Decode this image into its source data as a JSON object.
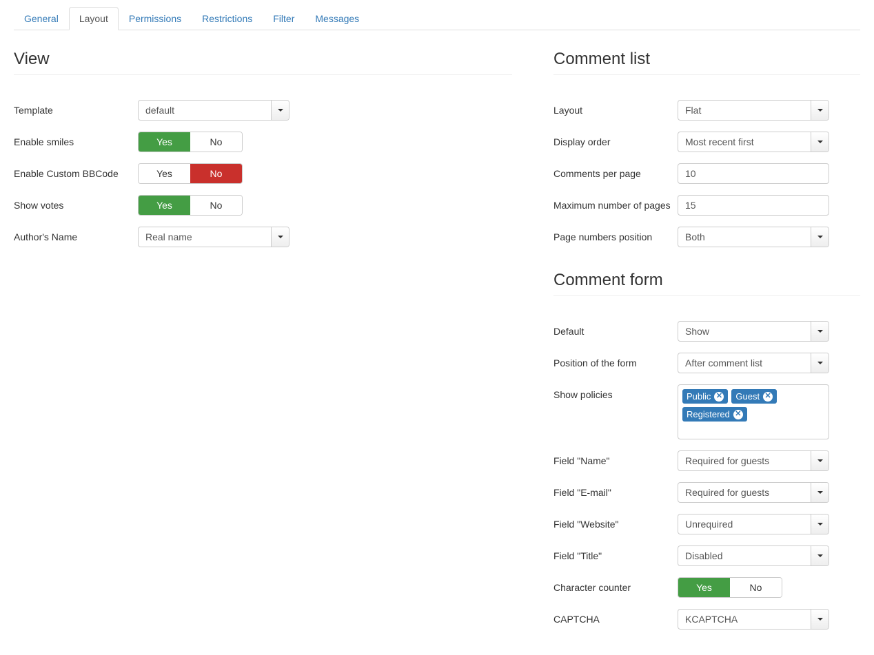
{
  "tabs": {
    "general": "General",
    "layout": "Layout",
    "permissions": "Permissions",
    "restrictions": "Restrictions",
    "filter": "Filter",
    "messages": "Messages"
  },
  "toggle": {
    "yes": "Yes",
    "no": "No"
  },
  "view": {
    "title": "View",
    "template": {
      "label": "Template",
      "value": "default"
    },
    "enable_smiles": {
      "label": "Enable smiles",
      "value": true
    },
    "enable_bbcode": {
      "label": "Enable Custom BBCode",
      "value": false
    },
    "show_votes": {
      "label": "Show votes",
      "value": true
    },
    "author_name": {
      "label": "Author's Name",
      "value": "Real name"
    }
  },
  "comment_list": {
    "title": "Comment list",
    "layout": {
      "label": "Layout",
      "value": "Flat"
    },
    "display_order": {
      "label": "Display order",
      "value": "Most recent first"
    },
    "per_page": {
      "label": "Comments per page",
      "value": "10"
    },
    "max_pages": {
      "label": "Maximum number of pages",
      "value": "15"
    },
    "page_pos": {
      "label": "Page numbers position",
      "value": "Both"
    }
  },
  "comment_form": {
    "title": "Comment form",
    "default": {
      "label": "Default",
      "value": "Show"
    },
    "position": {
      "label": "Position of the form",
      "value": "After comment list"
    },
    "show_policies": {
      "label": "Show policies",
      "tags": [
        "Public",
        "Guest",
        "Registered"
      ]
    },
    "field_name": {
      "label": "Field \"Name\"",
      "value": "Required for guests"
    },
    "field_email": {
      "label": "Field \"E-mail\"",
      "value": "Required for guests"
    },
    "field_website": {
      "label": "Field \"Website\"",
      "value": "Unrequired"
    },
    "field_title": {
      "label": "Field \"Title\"",
      "value": "Disabled"
    },
    "char_counter": {
      "label": "Character counter",
      "value": true
    },
    "captcha": {
      "label": "CAPTCHA",
      "value": "KCAPTCHA"
    }
  }
}
